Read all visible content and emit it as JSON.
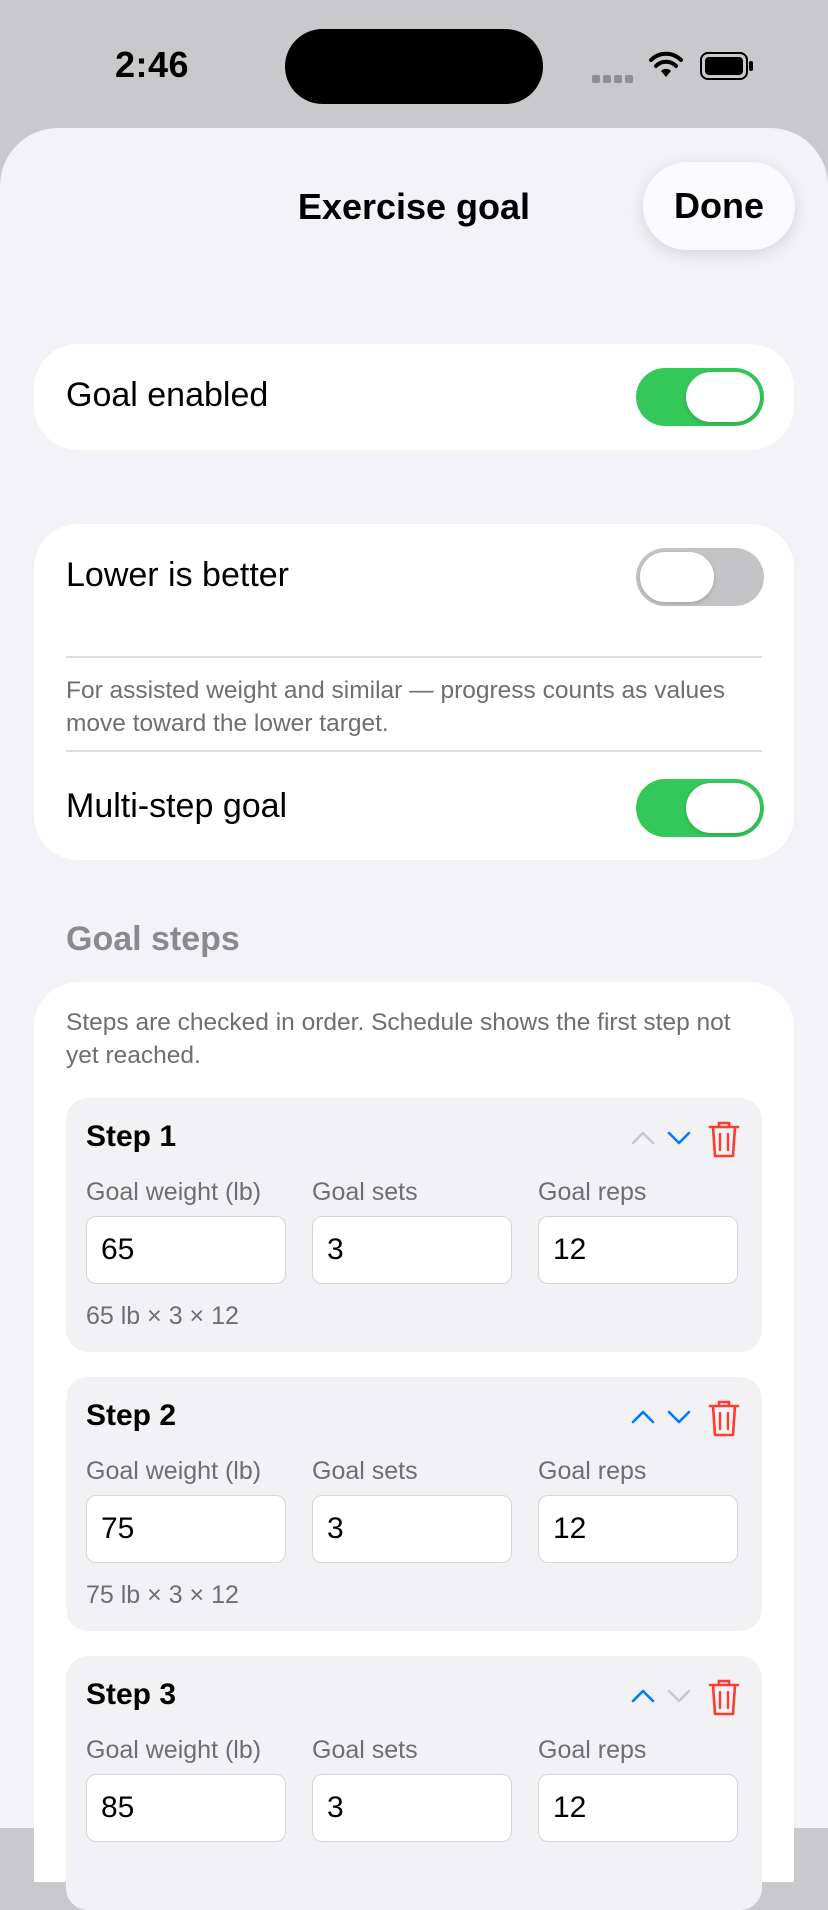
{
  "status_bar": {
    "time": "2:46"
  },
  "sheet": {
    "title": "Exercise goal",
    "done_label": "Done"
  },
  "goal_enabled": {
    "label": "Goal enabled",
    "on": true
  },
  "lower_is_better": {
    "label": "Lower is better",
    "on": false,
    "description": "For assisted weight and similar — progress counts as values move toward the lower target."
  },
  "multi_step": {
    "label": "Multi-step goal",
    "on": true
  },
  "goal_steps": {
    "header": "Goal steps",
    "description": "Steps are checked in order. Schedule shows the first step not yet reached.",
    "field_labels": {
      "weight": "Goal weight (lb)",
      "sets": "Goal sets",
      "reps": "Goal reps"
    },
    "steps": [
      {
        "title": "Step 1",
        "weight": "65",
        "sets": "3",
        "reps": "12",
        "summary": "65 lb × 3 × 12",
        "up_enabled": false,
        "down_enabled": true
      },
      {
        "title": "Step 2",
        "weight": "75",
        "sets": "3",
        "reps": "12",
        "summary": "75 lb × 3 × 12",
        "up_enabled": true,
        "down_enabled": true
      },
      {
        "title": "Step 3",
        "weight": "85",
        "sets": "3",
        "reps": "12",
        "summary": "",
        "up_enabled": true,
        "down_enabled": false
      }
    ]
  },
  "colors": {
    "accent": "#007aff",
    "switch_on": "#34c759",
    "delete": "#ff3b30",
    "chevron_disabled": "#c7c7cc"
  }
}
